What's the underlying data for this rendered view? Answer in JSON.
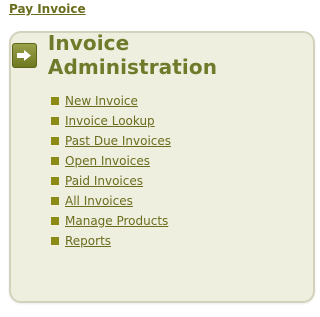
{
  "top_link": {
    "label": "Pay Invoice"
  },
  "panel": {
    "title": "Invoice Administration",
    "icon": "arrow-right-icon"
  },
  "menu": {
    "items": [
      {
        "label": "New Invoice"
      },
      {
        "label": "Invoice Lookup"
      },
      {
        "label": "Past Due Invoices"
      },
      {
        "label": "Open Invoices"
      },
      {
        "label": "Paid Invoices"
      },
      {
        "label": "All Invoices"
      },
      {
        "label": "Manage Products"
      },
      {
        "label": "Reports"
      }
    ]
  },
  "colors": {
    "text_olive": "#6b6d1e",
    "title_olive": "#6f7b2a",
    "bullet": "#8b8b16",
    "panel_bg": "#efefdf",
    "panel_border": "#d3d3bd",
    "icon_bg": "#7f8a2d"
  }
}
